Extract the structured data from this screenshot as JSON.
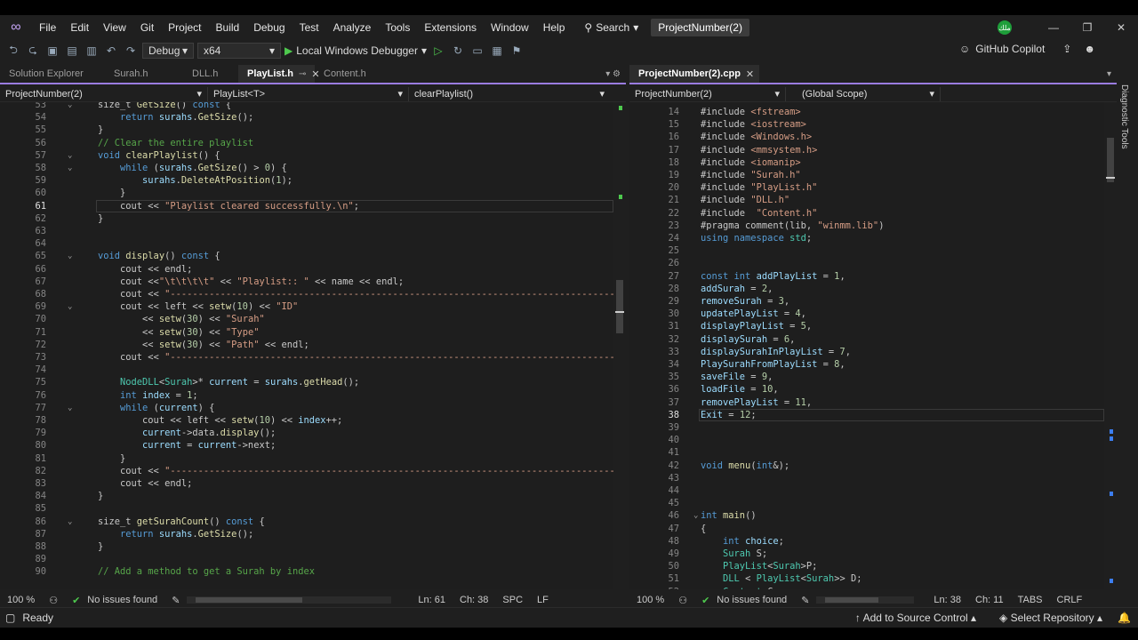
{
  "menu": {
    "items": [
      "File",
      "Edit",
      "View",
      "Git",
      "Project",
      "Build",
      "Debug",
      "Test",
      "Analyze",
      "Tools",
      "Extensions",
      "Window",
      "Help"
    ],
    "search": "Search",
    "solution": "ProjectNumber(2)",
    "avatar": "ملك"
  },
  "toolbar": {
    "config": "Debug",
    "platform": "x64",
    "debugger": "Local Windows Debugger",
    "copilot": "GitHub Copilot"
  },
  "left": {
    "tabs": [
      {
        "label": "Solution Explorer"
      },
      {
        "label": "Surah.h"
      },
      {
        "label": "DLL.h"
      },
      {
        "label": "PlayList.h",
        "active": true
      },
      {
        "label": "Content.h"
      }
    ],
    "nav": {
      "project": "ProjectNumber(2)",
      "scope": "PlayList<T>",
      "member": "clearPlaylist()"
    },
    "status": {
      "zoom": "100 %",
      "issues": "No issues found",
      "ln": "Ln: 61",
      "ch": "Ch: 38",
      "enc": "SPC",
      "eol": "LF"
    }
  },
  "right": {
    "tabs": [
      {
        "label": "ProjectNumber(2).cpp",
        "active": true
      }
    ],
    "nav": {
      "project": "ProjectNumber(2)",
      "scope": "(Global Scope)"
    },
    "status": {
      "zoom": "100 %",
      "issues": "No issues found",
      "ln": "Ln: 38",
      "ch": "Ch: 11",
      "enc": "TABS",
      "eol": "CRLF"
    }
  },
  "diagnostic": "Diagnostic Tools",
  "status": {
    "ready": "Ready",
    "source": "Add to Source Control",
    "repo": "Select Repository"
  },
  "colors": {
    "accent": "#9a7ce0",
    "ok": "#4ec94e"
  }
}
